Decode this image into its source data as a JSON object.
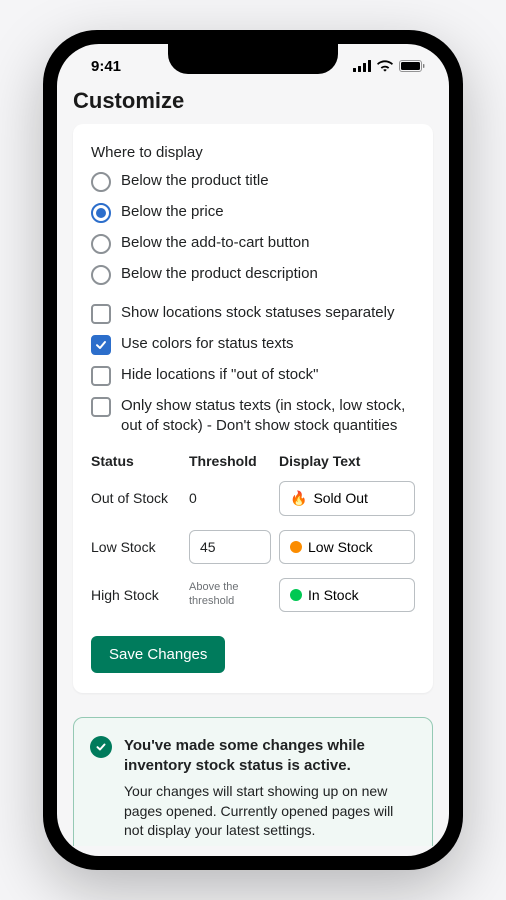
{
  "status_bar": {
    "time": "9:41"
  },
  "header": {
    "title": "Customize"
  },
  "where_to_display": {
    "label": "Where to display",
    "options": [
      {
        "label": "Below the product title",
        "selected": false
      },
      {
        "label": "Below the price",
        "selected": true
      },
      {
        "label": "Below the add-to-cart button",
        "selected": false
      },
      {
        "label": "Below the product description",
        "selected": false
      }
    ]
  },
  "checkboxes": [
    {
      "label": "Show locations stock statuses separately",
      "checked": false
    },
    {
      "label": "Use colors for status texts",
      "checked": true
    },
    {
      "label": "Hide locations if \"out of stock\"",
      "checked": false
    },
    {
      "label": "Only show status texts (in stock, low stock, out of stock) - Don't show stock quantities",
      "checked": false
    }
  ],
  "table": {
    "headers": {
      "status": "Status",
      "threshold": "Threshold",
      "display": "Display Text"
    },
    "rows": [
      {
        "status": "Out of Stock",
        "threshold": "0",
        "display_prefix": "🔥",
        "display": "Sold Out"
      },
      {
        "status": "Low Stock",
        "threshold": "45",
        "display": "Low Stock"
      },
      {
        "status": "High Stock",
        "threshold_note": "Above the threshold",
        "display": "In Stock"
      }
    ]
  },
  "save_button": "Save Changes",
  "notice": {
    "title": "You've made some changes while inventory stock status is active.",
    "body": "Your changes will start showing up on new pages opened. Currently opened pages will not display your latest settings."
  }
}
